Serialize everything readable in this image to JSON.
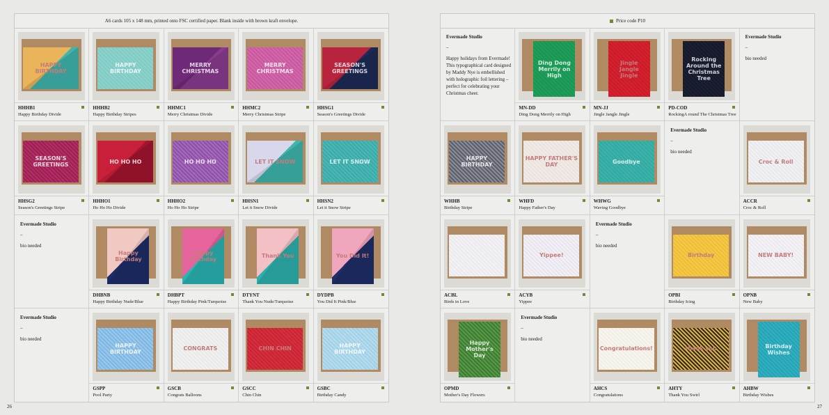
{
  "left_page": {
    "header": "A6 cards 105 x 148 mm, printed onto FSC certified paper.     Blank inside with brown kraft envelope.",
    "page_number": "26",
    "products": [
      {
        "code": "HHHB1",
        "name": "Happy Birthday Divide",
        "card_text": "HAPPY BIRTHDAY",
        "colors": [
          "#e9b45a",
          "#3fb5ad"
        ]
      },
      {
        "code": "HHHB2",
        "name": "Happy Birthday Stripes",
        "card_text": "HAPPY BIRTHDAY",
        "colors": [
          "#7ecbc4",
          "#8fd2cc"
        ]
      },
      {
        "code": "HHMC1",
        "name": "Merry Christmas Divide",
        "card_text": "MERRY CHRISTMAS",
        "colors": [
          "#6f2a77",
          "#8a3b90"
        ]
      },
      {
        "code": "HHMC2",
        "name": "Merry Christmas Stripe",
        "card_text": "MERRY CHRISTMAS",
        "colors": [
          "#c9569e",
          "#d06aa8"
        ]
      },
      {
        "code": "HHSG1",
        "name": "Season's Greetings Divide",
        "card_text": "SEASON'S GREETINGS",
        "colors": [
          "#b8243d",
          "#1d2a56"
        ]
      },
      {
        "code": "HHSG2",
        "name": "Season's Greetings Stripe",
        "card_text": "SEASON'S GREETINGS",
        "colors": [
          "#9b1f56",
          "#b2305f"
        ]
      },
      {
        "code": "HHHO1",
        "name": "Ho Ho Ho Divide",
        "card_text": "HO HO HO",
        "colors": [
          "#c8203a",
          "#a31530"
        ]
      },
      {
        "code": "HHHO2",
        "name": "Ho Ho Ho Stripe",
        "card_text": "HO HO HO",
        "colors": [
          "#8e4fa7",
          "#a26bbb"
        ]
      },
      {
        "code": "HHSN1",
        "name": "Let it Snow Divide",
        "card_text": "LET IT SNOW",
        "colors": [
          "#d8d8ea",
          "#3eb6ad"
        ]
      },
      {
        "code": "HHSN2",
        "name": "Let it Snow Stripe",
        "card_text": "LET IT SNOW",
        "colors": [
          "#4cb8b6",
          "#3aa9a7"
        ]
      },
      {
        "code": "DHBNB",
        "name": "Happy Birthday Nude/Blue",
        "card_text": "Happy Birthday",
        "colors": [
          "#f1c9c3",
          "#1c2c66"
        ]
      },
      {
        "code": "DHBPT",
        "name": "Happy Birthday Pink/Turquoise",
        "card_text": "Happy Birthday",
        "colors": [
          "#e6649c",
          "#2ab3b1"
        ]
      },
      {
        "code": "DTYNT",
        "name": "Thank You Nude/Turquoise",
        "card_text": "Thank You",
        "colors": [
          "#f3c1c5",
          "#2cb0ad"
        ]
      },
      {
        "code": "DYDPB",
        "name": "You Did It Pink/Blue",
        "card_text": "You Did It!",
        "colors": [
          "#f0a6bd",
          "#1f2d69"
        ]
      },
      {
        "code": "GSPP",
        "name": "Pool Party",
        "card_text": "HAPPY BIRTHDAY",
        "colors": [
          "#7cb6e2",
          "#9ac7ea"
        ]
      },
      {
        "code": "GSCB",
        "name": "Congrats Balloons",
        "card_text": "CONGRATS",
        "colors": [
          "#f2f2f2",
          "#e8e8e8"
        ]
      },
      {
        "code": "GSCC",
        "name": "Chin Chin",
        "card_text": "CHIN CHIN",
        "colors": [
          "#d8303e",
          "#c42534"
        ]
      },
      {
        "code": "GSBC",
        "name": "Birthday Candy",
        "card_text": "HAPPY BIRTHDAY",
        "colors": [
          "#9fd0e6",
          "#b7dced"
        ]
      }
    ],
    "bios": [
      {
        "title": "Evermade Studio",
        "dash": "–",
        "body": "bio needed"
      },
      {
        "title": "Evermade Studio",
        "dash": "–",
        "body": "bio needed"
      }
    ]
  },
  "right_page": {
    "header": "Price code P10",
    "page_number": "27",
    "products": [
      {
        "code": "MN-DD",
        "name": "Ding Dong Merrily on High",
        "card_text": "Ding Dong Merrily on High",
        "colors": [
          "#1ea05a",
          "#1a9453"
        ]
      },
      {
        "code": "MN-JJ",
        "name": "Jingle Jangle Jingle",
        "card_text": "Jingle Jangle Jingle",
        "colors": [
          "#d8202f",
          "#c71c2a"
        ]
      },
      {
        "code": "PD-COD",
        "name": "RockingA round The Christmas Tree",
        "card_text": "Rocking Around the Christmas Tree",
        "colors": [
          "#1b2035",
          "#141828"
        ]
      },
      {
        "code": "WHHB",
        "name": "Birthday Stripe",
        "card_text": "HAPPY BIRTHDAY",
        "colors": [
          "#8b8d97",
          "#5a5d6a"
        ]
      },
      {
        "code": "WHFD",
        "name": "Happy Father's Day",
        "card_text": "HAPPY FATHER'S DAY",
        "colors": [
          "#f1ece8",
          "#e9e2dc"
        ]
      },
      {
        "code": "WHWG",
        "name": "Waving Goodbye",
        "card_text": "Goodbye",
        "colors": [
          "#3db4ab",
          "#32a89f"
        ]
      },
      {
        "code": "ACCR",
        "name": "Croc & Roll",
        "card_text": "Croc & Roll",
        "colors": [
          "#f2f2f3",
          "#e7e8ec"
        ]
      },
      {
        "code": "ACBL",
        "name": "Birds in Love",
        "card_text": "",
        "colors": [
          "#f3f3f5",
          "#eaeaee"
        ]
      },
      {
        "code": "ACYB",
        "name": "Yippee",
        "card_text": "Yippee!",
        "colors": [
          "#f4f2f6",
          "#e8e4ee"
        ]
      },
      {
        "code": "OPBI",
        "name": "Birthday Icing",
        "card_text": "Birthday",
        "colors": [
          "#f5c94a",
          "#efbd34"
        ]
      },
      {
        "code": "OPNB",
        "name": "New Baby",
        "card_text": "NEW BABY!",
        "colors": [
          "#f4f4f6",
          "#e9e9ee"
        ]
      },
      {
        "code": "OPMD",
        "name": "Mother's Day Flowers",
        "card_text": "Happy Mother's Day",
        "colors": [
          "#3a7a3a",
          "#5a9a3f"
        ]
      },
      {
        "code": "AHCS",
        "name": "Congratulations",
        "card_text": "Congratulations!",
        "colors": [
          "#f8f6f0",
          "#f0ede4"
        ]
      },
      {
        "code": "AHTY",
        "name": "Thank You Swirl",
        "card_text": "thank you",
        "colors": [
          "#e6b33a",
          "#2a2a2a"
        ]
      },
      {
        "code": "AHBW",
        "name": "Birthday Wishes",
        "card_text": "Birthday Wishes",
        "colors": [
          "#2fb1c1",
          "#27a2b2"
        ]
      }
    ],
    "bios": [
      {
        "title": "Evermade Studio",
        "dash": "–",
        "body": "Happy holidays from Evermade! This typographical card designed by Maddy Nye is embellished with holographic foil lettering – perfect for celebrating your Christmas cheer."
      },
      {
        "title": "Evermade Studio",
        "dash": "–",
        "body": "bio needed"
      },
      {
        "title": "Evermade Studio",
        "dash": "–",
        "body": "bio needed"
      },
      {
        "title": "Evermade Studio",
        "dash": "–",
        "body": "bio needed"
      },
      {
        "title": "Evermade Studio",
        "dash": "–",
        "body": "bio needed"
      }
    ]
  },
  "colors": {
    "accent_square": "#6d8c34",
    "envelope": "#b08a62",
    "page_bg": "#eeeeed"
  }
}
